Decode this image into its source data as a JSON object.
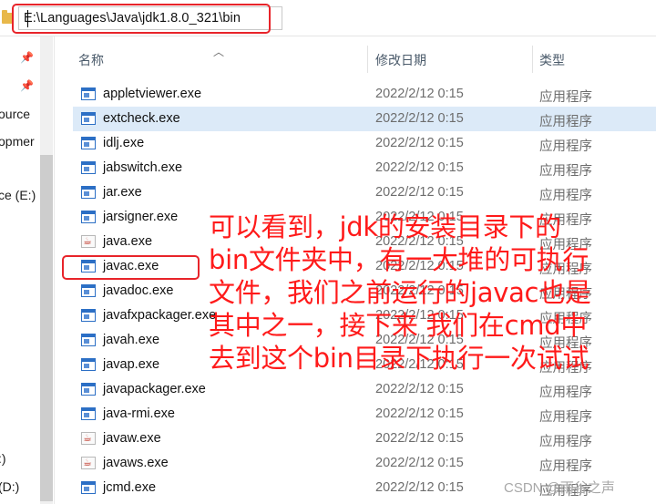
{
  "address_bar": {
    "path": "E:\\Languages\\Java\\jdk1.8.0_321\\bin"
  },
  "nav_pane": {
    "items": [
      {
        "label": "ource"
      },
      {
        "label": "opmer"
      },
      {
        "label": "ce (E:)"
      },
      {
        "label": ":)"
      },
      {
        "label": "(D:)"
      }
    ]
  },
  "columns": {
    "name": "名称",
    "date": "修改日期",
    "type": "类型"
  },
  "files": [
    {
      "name": "appletviewer.exe",
      "date": "2022/2/12 0:15",
      "type": "应用程序",
      "icon": "exe-window-icon"
    },
    {
      "name": "extcheck.exe",
      "date": "2022/2/12 0:15",
      "type": "应用程序",
      "icon": "exe-window-icon"
    },
    {
      "name": "idlj.exe",
      "date": "2022/2/12 0:15",
      "type": "应用程序",
      "icon": "exe-window-icon"
    },
    {
      "name": "jabswitch.exe",
      "date": "2022/2/12 0:15",
      "type": "应用程序",
      "icon": "exe-window-icon"
    },
    {
      "name": "jar.exe",
      "date": "2022/2/12 0:15",
      "type": "应用程序",
      "icon": "exe-window-icon"
    },
    {
      "name": "jarsigner.exe",
      "date": "2022/2/12 0:15",
      "type": "应用程序",
      "icon": "exe-window-icon"
    },
    {
      "name": "java.exe",
      "date": "2022/2/12 0:15",
      "type": "应用程序",
      "icon": "java-cup-icon"
    },
    {
      "name": "javac.exe",
      "date": "2022/2/12 0:15",
      "type": "应用程序",
      "icon": "exe-window-icon"
    },
    {
      "name": "javadoc.exe",
      "date": "2022/2/12 0:15",
      "type": "应用程序",
      "icon": "exe-window-icon"
    },
    {
      "name": "javafxpackager.exe",
      "date": "2022/2/12 0:15",
      "type": "应用程序",
      "icon": "exe-window-icon"
    },
    {
      "name": "javah.exe",
      "date": "2022/2/12 0:15",
      "type": "应用程序",
      "icon": "exe-window-icon"
    },
    {
      "name": "javap.exe",
      "date": "2022/2/12 0:15",
      "type": "应用程序",
      "icon": "exe-window-icon"
    },
    {
      "name": "javapackager.exe",
      "date": "2022/2/12 0:15",
      "type": "应用程序",
      "icon": "exe-window-icon"
    },
    {
      "name": "java-rmi.exe",
      "date": "2022/2/12 0:15",
      "type": "应用程序",
      "icon": "exe-window-icon"
    },
    {
      "name": "javaw.exe",
      "date": "2022/2/12 0:15",
      "type": "应用程序",
      "icon": "java-cup-icon"
    },
    {
      "name": "javaws.exe",
      "date": "2022/2/12 0:15",
      "type": "应用程序",
      "icon": "java-cup-icon"
    },
    {
      "name": "jcmd.exe",
      "date": "2022/2/12 0:15",
      "type": "应用程序",
      "icon": "exe-window-icon"
    }
  ],
  "annotation": {
    "lines": [
      "可以看到，jdk的安装目录下的",
      "bin文件夹中，有一大堆的可执行",
      "文件，我们之前运行的javac也是",
      "其中之一，接下来 我们在cmd中",
      "去到这个bin目录下执行一次试试"
    ]
  },
  "watermark": "CSDN @雨谷之声",
  "colors": {
    "annotation": "#ff1a1a",
    "highlight_box": "#e8242a",
    "selected_row": "#dceaf8"
  }
}
